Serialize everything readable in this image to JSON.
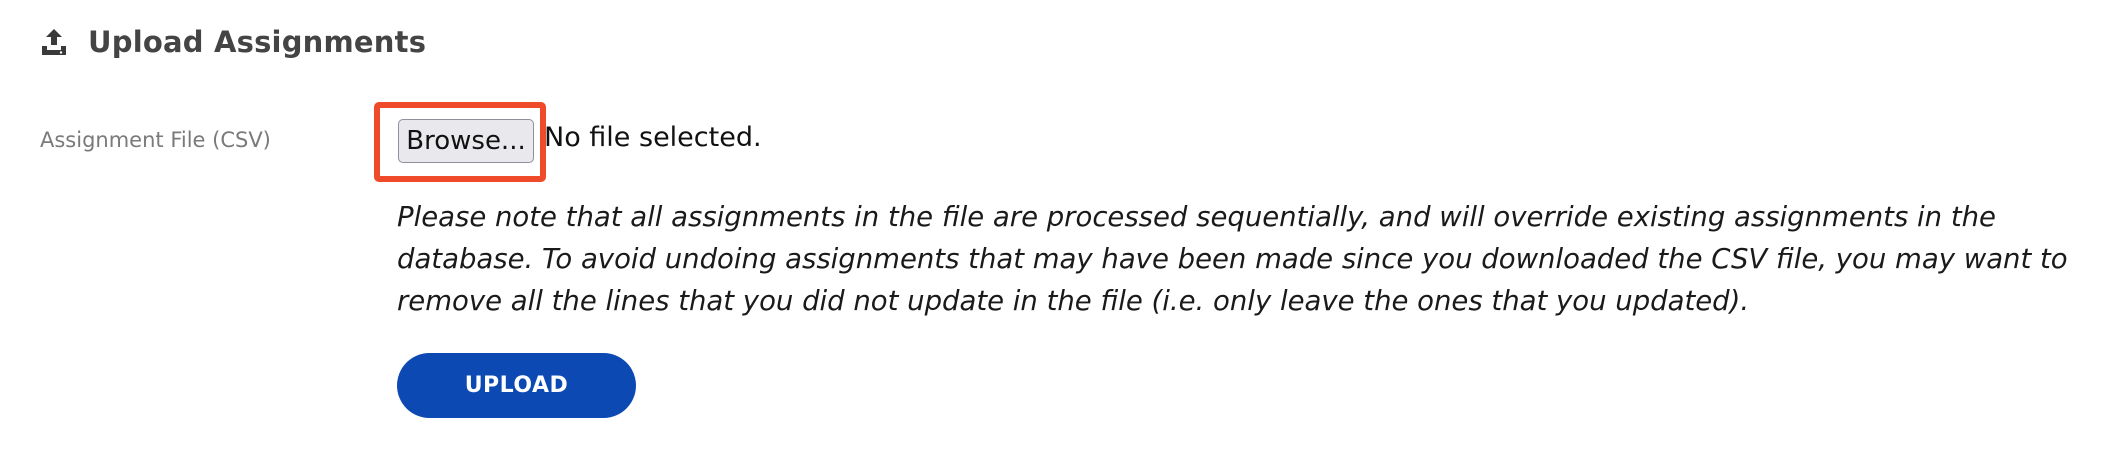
{
  "section": {
    "title": "Upload Assignments",
    "icon": "upload-tray-icon"
  },
  "form": {
    "field_label": "Assignment File (CSV)",
    "browse_label": "Browse...",
    "file_status": "No file selected.",
    "note": "Please note that all assignments in the file are processed sequentially, and will override existing assignments in the database. To avoid undoing assignments that may have been made since you downloaded the CSV file, you may want to remove all the lines that you did not update in the file (i.e. only leave the ones that you updated).",
    "upload_label": "UPLOAD"
  },
  "colors": {
    "highlight": "#ef4a2a",
    "primary_button": "#0c49b2",
    "label_gray": "#7a7a7a"
  }
}
